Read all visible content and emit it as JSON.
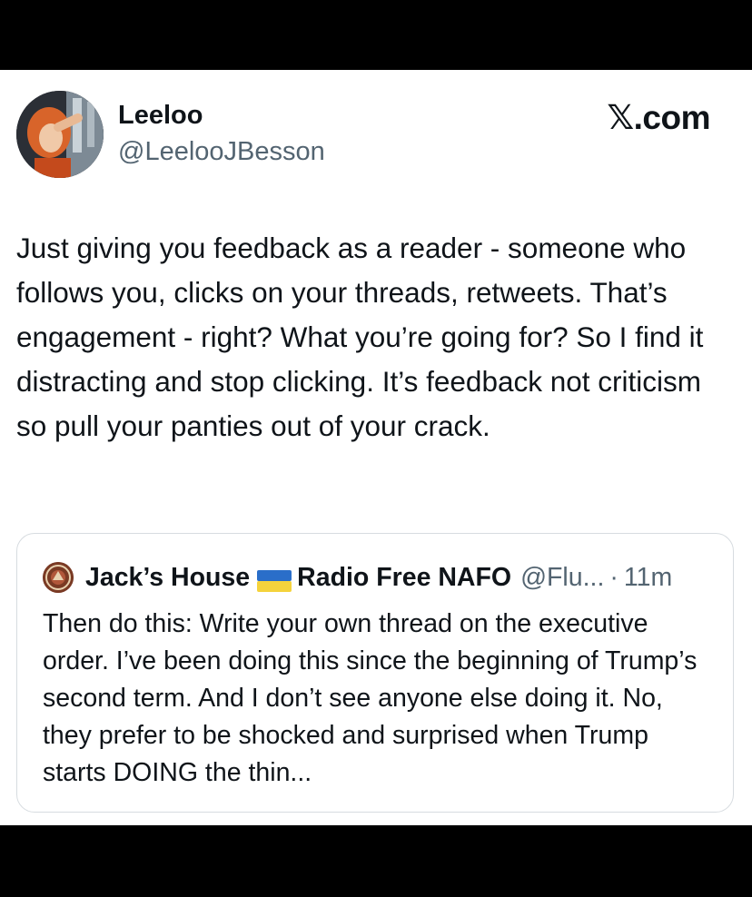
{
  "tweet": {
    "author_name": "Leeloo",
    "author_handle": "@LeelooJBesson",
    "brand": "𝕏.com",
    "text": "Just giving you feedback as a reader - someone who follows you, clicks on your threads, retweets. That’s engagement - right? What you’re going for? So I find it distracting and stop clicking. It’s feedback not criticism so pull your panties out of your crack."
  },
  "quoted_tweet": {
    "author_name_part1": "Jack’s House",
    "author_name_part2": "Radio Free NAFO",
    "author_handle": "@Flu...",
    "separator": "·",
    "time": "11m",
    "text": "Then do this: Write your own thread on the executive order. I’ve been doing this since the beginning of Trump’s second term. And I don’t see anyone else doing it. No, they prefer to be shocked and surprised when Trump starts DOING the thin..."
  },
  "colors": {
    "text_primary": "#0f1419",
    "text_secondary": "#536471",
    "border": "#d7dce0",
    "flag_blue": "#2a6ec9",
    "flag_yellow": "#f5d33c"
  },
  "icons": [
    "avatar",
    "ukraine-flag-icon",
    "quoted-avatar"
  ]
}
